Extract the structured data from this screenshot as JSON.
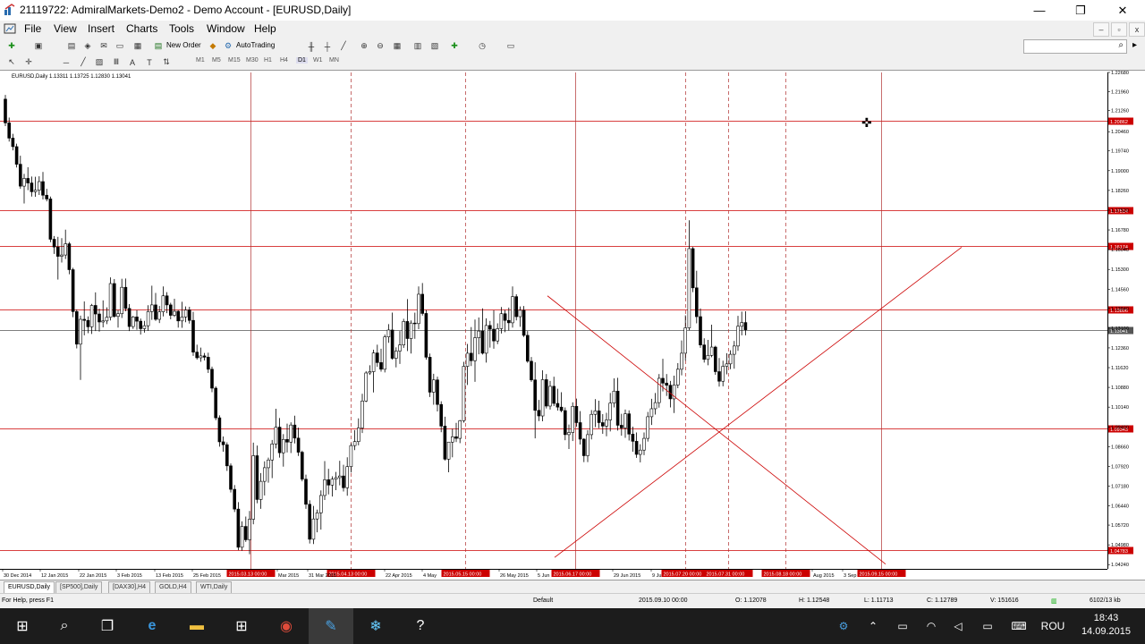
{
  "window": {
    "title": "21119722: AdmiralMarkets-Demo2 - Demo Account - [EURUSD,Daily]",
    "minimize": "—",
    "maximize": "❐",
    "close": "✕"
  },
  "menu": {
    "items": [
      "File",
      "View",
      "Insert",
      "Charts",
      "Tools",
      "Window",
      "Help"
    ]
  },
  "mdi": {
    "minimize": "–",
    "restore": "▫",
    "close": "x"
  },
  "toolbar": {
    "new_order": "New Order",
    "autotrading": "AutoTrading",
    "timeframes": [
      "M1",
      "M5",
      "M15",
      "M30",
      "H1",
      "H4",
      "D1",
      "W1",
      "MN"
    ]
  },
  "chart_info": {
    "text": "EURUSD,Daily  1.13311 1.13725 1.12830 1.13041"
  },
  "chart_data": {
    "type": "candlestick",
    "symbol": "EURUSD",
    "timeframe": "Daily",
    "ylim": [
      1.0408,
      1.2268
    ],
    "y_ticks": [
      "1.22680",
      "1.21960",
      "1.21260",
      "1.20460",
      "1.19740",
      "1.19000",
      "1.18260",
      "1.17520",
      "1.16780",
      "1.16040",
      "1.15300",
      "1.14560",
      "1.13840",
      "1.13100",
      "1.12360",
      "1.11620",
      "1.10880",
      "1.10140",
      "1.09400",
      "1.08660",
      "1.07920",
      "1.07180",
      "1.06440",
      "1.05720",
      "1.04980",
      "1.04240"
    ],
    "x_ticks": [
      "30 Dec 2014",
      "12 Jan 2015",
      "22 Jan 2015",
      "3 Feb 2015",
      "13 Feb 2015",
      "25 Feb 2015",
      "Mar 2015",
      "31 Mar 2015",
      "22 Apr 2015",
      "4 May",
      "26 May 2015",
      "5 Jun",
      "29 Jun 2015",
      "9 Ju",
      "Aug 2015",
      "3 Sep"
    ],
    "hlines": [
      {
        "price": "1.20862",
        "color": "#cc0000"
      },
      {
        "price": "1.17514",
        "color": "#cc0000"
      },
      {
        "price": "1.16174",
        "color": "#cc0000"
      },
      {
        "price": "1.13806",
        "color": "#cc0000"
      },
      {
        "price": "1.13041",
        "color": "#555555"
      },
      {
        "price": "1.09343",
        "color": "#cc0000"
      },
      {
        "price": "1.04783",
        "color": "#cc0000"
      }
    ],
    "vline_labels": [
      "2015.03.13 00:00",
      "2015.04.13 00:00",
      "2015.05.15 00:00",
      "2015.06.17 00:00",
      "2015.07.20 00:00",
      "2015.07.31 00:00",
      "2015.08.18 00:00",
      "2015.09.15 00:00"
    ],
    "candles": [
      [
        1.2168,
        1.2184,
        1.2067,
        1.2079
      ],
      [
        1.2079,
        1.2099,
        1.2009,
        1.2022
      ],
      [
        1.2022,
        1.2038,
        1.1976,
        1.199
      ],
      [
        1.199,
        1.2001,
        1.1912,
        1.1924
      ],
      [
        1.1924,
        1.1956,
        1.1832,
        1.1842
      ],
      [
        1.1842,
        1.1888,
        1.1777,
        1.1871
      ],
      [
        1.1871,
        1.1913,
        1.1827,
        1.1854
      ],
      [
        1.1854,
        1.1878,
        1.1803,
        1.1821
      ],
      [
        1.1821,
        1.1877,
        1.1802,
        1.1827
      ],
      [
        1.1827,
        1.1879,
        1.1809,
        1.1859
      ],
      [
        1.1859,
        1.1895,
        1.1792,
        1.1808
      ],
      [
        1.1808,
        1.1832,
        1.1785,
        1.1794
      ],
      [
        1.1794,
        1.1803,
        1.1632,
        1.1643
      ],
      [
        1.1643,
        1.1655,
        1.1588,
        1.1614
      ],
      [
        1.1614,
        1.1652,
        1.1492,
        1.1579
      ],
      [
        1.1579,
        1.1647,
        1.1556,
        1.1584
      ],
      [
        1.1584,
        1.1679,
        1.1569,
        1.1626
      ],
      [
        1.1626,
        1.1633,
        1.1512,
        1.1529
      ],
      [
        1.1529,
        1.1536,
        1.1351,
        1.1372
      ],
      [
        1.1372,
        1.138,
        1.1234,
        1.125
      ],
      [
        1.125,
        1.1357,
        1.1116,
        1.1343
      ],
      [
        1.1343,
        1.141,
        1.1283,
        1.1339
      ],
      [
        1.1339,
        1.1354,
        1.1291,
        1.1315
      ],
      [
        1.1315,
        1.1401,
        1.1288,
        1.1395
      ],
      [
        1.1395,
        1.1444,
        1.1299,
        1.1363
      ],
      [
        1.1363,
        1.1383,
        1.1297,
        1.1333
      ],
      [
        1.1333,
        1.1414,
        1.1313,
        1.1337
      ],
      [
        1.1337,
        1.1388,
        1.1325,
        1.1351
      ],
      [
        1.1351,
        1.15,
        1.1339,
        1.1477
      ],
      [
        1.1477,
        1.1494,
        1.1349,
        1.1354
      ],
      [
        1.1354,
        1.1378,
        1.1312,
        1.1364
      ],
      [
        1.1364,
        1.1495,
        1.1348,
        1.1463
      ],
      [
        1.1463,
        1.1496,
        1.1373,
        1.1384
      ],
      [
        1.1384,
        1.14,
        1.1299,
        1.1316
      ],
      [
        1.1316,
        1.1356,
        1.1307,
        1.1352
      ],
      [
        1.1352,
        1.1377,
        1.1304,
        1.1336
      ],
      [
        1.1336,
        1.1346,
        1.1286,
        1.1308
      ],
      [
        1.1308,
        1.1337,
        1.1293,
        1.1319
      ],
      [
        1.1319,
        1.1396,
        1.13,
        1.1372
      ],
      [
        1.1372,
        1.1469,
        1.1341,
        1.1397
      ],
      [
        1.1397,
        1.1442,
        1.1337,
        1.1343
      ],
      [
        1.1343,
        1.1393,
        1.1329,
        1.1371
      ],
      [
        1.1371,
        1.1466,
        1.1354,
        1.1431
      ],
      [
        1.1431,
        1.1445,
        1.1366,
        1.1397
      ],
      [
        1.1397,
        1.1405,
        1.1343,
        1.1358
      ],
      [
        1.1358,
        1.142,
        1.1352,
        1.1373
      ],
      [
        1.1373,
        1.1377,
        1.1312,
        1.1337
      ],
      [
        1.1337,
        1.1409,
        1.1311,
        1.1352
      ],
      [
        1.1352,
        1.1391,
        1.1332,
        1.1378
      ],
      [
        1.1378,
        1.139,
        1.1327,
        1.1339
      ],
      [
        1.1339,
        1.1371,
        1.1206,
        1.122
      ],
      [
        1.122,
        1.1248,
        1.1192,
        1.1199
      ],
      [
        1.1199,
        1.1237,
        1.1184,
        1.1206
      ],
      [
        1.1206,
        1.1217,
        1.1189,
        1.1201
      ],
      [
        1.1201,
        1.1218,
        1.1142,
        1.1156
      ],
      [
        1.1156,
        1.1166,
        1.107,
        1.1085
      ],
      [
        1.1085,
        1.1092,
        1.0965,
        1.0974
      ],
      [
        1.0974,
        1.0983,
        1.0866,
        1.0884
      ],
      [
        1.0884,
        1.0904,
        1.0847,
        1.0873
      ],
      [
        1.0873,
        1.0882,
        1.0775,
        1.0794
      ],
      [
        1.0794,
        1.0803,
        1.0694,
        1.0706
      ],
      [
        1.0706,
        1.0722,
        1.0621,
        1.0632
      ],
      [
        1.0632,
        1.0658,
        1.0478,
        1.0489
      ],
      [
        1.0489,
        1.0586,
        1.0476,
        1.0567
      ],
      [
        1.0567,
        1.0604,
        1.0509,
        1.0517
      ],
      [
        1.0517,
        1.0625,
        1.0463,
        1.0594
      ],
      [
        1.0594,
        1.0881,
        1.0575,
        1.0832
      ],
      [
        1.0832,
        1.087,
        1.0654,
        1.0668
      ],
      [
        1.0668,
        1.0767,
        1.0633,
        1.0736
      ],
      [
        1.0736,
        1.0811,
        1.0683,
        1.0787
      ],
      [
        1.0787,
        1.0825,
        1.0731,
        1.0816
      ],
      [
        1.0816,
        1.0891,
        1.0748,
        1.0876
      ],
      [
        1.0876,
        1.1008,
        1.0859,
        1.0939
      ],
      [
        1.0939,
        1.0973,
        1.0825,
        1.0843
      ],
      [
        1.0843,
        1.0913,
        1.0791,
        1.0893
      ],
      [
        1.0893,
        1.0952,
        1.0844,
        1.0883
      ],
      [
        1.0883,
        1.0957,
        1.0842,
        1.0947
      ],
      [
        1.0947,
        1.0982,
        1.0878,
        1.0898
      ],
      [
        1.0898,
        1.0937,
        1.0831,
        1.0845
      ],
      [
        1.0845,
        1.0851,
        1.0736,
        1.0744
      ],
      [
        1.0744,
        1.0761,
        1.0633,
        1.065
      ],
      [
        1.065,
        1.0665,
        1.0503,
        1.0519
      ],
      [
        1.0519,
        1.0644,
        1.0501,
        1.0595
      ],
      [
        1.0595,
        1.063,
        1.0545,
        1.0618
      ],
      [
        1.0618,
        1.0702,
        1.0555,
        1.0683
      ],
      [
        1.0683,
        1.0812,
        1.0666,
        1.0742
      ],
      [
        1.0742,
        1.0783,
        1.0687,
        1.0722
      ],
      [
        1.0722,
        1.0755,
        1.0679,
        1.0744
      ],
      [
        1.0744,
        1.0771,
        1.0703,
        1.075
      ],
      [
        1.075,
        1.0813,
        1.0721,
        1.0756
      ],
      [
        1.0756,
        1.0798,
        1.0698,
        1.0712
      ],
      [
        1.0712,
        1.0826,
        1.0682,
        1.0791
      ],
      [
        1.0791,
        1.0879,
        1.0769,
        1.087
      ],
      [
        1.087,
        1.0928,
        1.0853,
        1.0885
      ],
      [
        1.0885,
        1.0972,
        1.0871,
        1.0936
      ],
      [
        1.0936,
        1.1064,
        1.0917,
        1.1037
      ],
      [
        1.1037,
        1.1149,
        1.1033,
        1.1142
      ],
      [
        1.1142,
        1.1171,
        1.1135,
        1.1147
      ],
      [
        1.1147,
        1.1229,
        1.1069,
        1.1217
      ],
      [
        1.1217,
        1.1248,
        1.1165,
        1.1181
      ],
      [
        1.1181,
        1.1233,
        1.1147,
        1.1156
      ],
      [
        1.1156,
        1.1286,
        1.1144,
        1.1277
      ],
      [
        1.1277,
        1.1325,
        1.1255,
        1.1303
      ],
      [
        1.1303,
        1.1368,
        1.1192,
        1.1197
      ],
      [
        1.1197,
        1.1238,
        1.1163,
        1.1224
      ],
      [
        1.1224,
        1.1299,
        1.1176,
        1.1247
      ],
      [
        1.1247,
        1.1345,
        1.1236,
        1.1335
      ],
      [
        1.1335,
        1.1419,
        1.1224,
        1.1271
      ],
      [
        1.1271,
        1.1339,
        1.1215,
        1.1329
      ],
      [
        1.1329,
        1.1368,
        1.127,
        1.1327
      ],
      [
        1.1327,
        1.1466,
        1.1306,
        1.1437
      ],
      [
        1.1437,
        1.1479,
        1.1357,
        1.1365
      ],
      [
        1.1365,
        1.1378,
        1.1192,
        1.1201
      ],
      [
        1.1201,
        1.1215,
        1.1052,
        1.107
      ],
      [
        1.107,
        1.1139,
        1.1023,
        1.1116
      ],
      [
        1.1116,
        1.1128,
        1.0998,
        1.1024
      ],
      [
        1.1024,
        1.1036,
        1.092,
        1.0943
      ],
      [
        1.0943,
        1.0978,
        1.0814,
        1.0819
      ],
      [
        1.0819,
        1.0884,
        1.077,
        1.0883
      ],
      [
        1.0883,
        1.0933,
        1.0826,
        1.0903
      ],
      [
        1.0903,
        1.0955,
        1.0883,
        1.0897
      ],
      [
        1.0897,
        1.0966,
        1.0879,
        1.0963
      ],
      [
        1.0963,
        1.1184,
        1.0956,
        1.1167
      ],
      [
        1.1167,
        1.1251,
        1.1097,
        1.1216
      ],
      [
        1.1216,
        1.1314,
        1.1168,
        1.1188
      ],
      [
        1.1188,
        1.1342,
        1.1109,
        1.1274
      ],
      [
        1.1274,
        1.135,
        1.1212,
        1.1299
      ],
      [
        1.1299,
        1.1384,
        1.1211,
        1.1216
      ],
      [
        1.1216,
        1.1347,
        1.1181,
        1.132
      ],
      [
        1.132,
        1.1337,
        1.1237,
        1.1306
      ],
      [
        1.1306,
        1.1377,
        1.1233,
        1.1262
      ],
      [
        1.1262,
        1.1328,
        1.125,
        1.1308
      ],
      [
        1.1308,
        1.1389,
        1.129,
        1.1364
      ],
      [
        1.1364,
        1.1378,
        1.1295,
        1.1339
      ],
      [
        1.1339,
        1.1387,
        1.1301,
        1.133
      ],
      [
        1.133,
        1.1466,
        1.1312,
        1.1428
      ],
      [
        1.1428,
        1.1437,
        1.1339,
        1.1353
      ],
      [
        1.1353,
        1.1391,
        1.1315,
        1.1377
      ],
      [
        1.1377,
        1.1393,
        1.1277,
        1.1283
      ],
      [
        1.1283,
        1.1299,
        1.118,
        1.1186
      ],
      [
        1.1186,
        1.1202,
        1.1109,
        1.1116
      ],
      [
        1.1116,
        1.1182,
        1.0897,
        1.1002
      ],
      [
        1.1002,
        1.1041,
        1.0962,
        1.0981
      ],
      [
        1.0981,
        1.1152,
        1.0961,
        1.1117
      ],
      [
        1.1117,
        1.1138,
        1.1009,
        1.1018
      ],
      [
        1.1018,
        1.1112,
        1.1005,
        1.1092
      ],
      [
        1.1092,
        1.1128,
        1.1018,
        1.1028
      ],
      [
        1.1028,
        1.1083,
        1.1001,
        1.1014
      ],
      [
        1.1014,
        1.107,
        1.0995,
        1.1001
      ],
      [
        1.1001,
        1.1013,
        1.089,
        1.0911
      ],
      [
        1.0911,
        1.0949,
        1.0857,
        1.0919
      ],
      [
        1.0919,
        1.1032,
        1.0887,
        1.1017
      ],
      [
        1.1017,
        1.1046,
        1.0941,
        1.0956
      ],
      [
        1.0956,
        1.0999,
        1.0874,
        1.0894
      ],
      [
        1.0894,
        1.0898,
        1.0808,
        1.0832
      ],
      [
        1.0832,
        1.0928,
        1.0808,
        1.0911
      ],
      [
        1.0911,
        1.1003,
        1.0893,
        1.0987
      ],
      [
        1.0987,
        1.1044,
        1.0939,
        1.1
      ],
      [
        1.1,
        1.1038,
        1.0935,
        1.0956
      ],
      [
        1.0956,
        1.0988,
        1.0914,
        1.0943
      ],
      [
        1.0943,
        1.0993,
        1.0905,
        1.0966
      ],
      [
        1.0966,
        1.1067,
        1.0923,
        1.1029
      ],
      [
        1.1029,
        1.1122,
        1.1013,
        1.1074
      ],
      [
        1.1074,
        1.1124,
        1.0926,
        1.0946
      ],
      [
        1.0946,
        1.0989,
        1.0907,
        1.0936
      ],
      [
        1.0936,
        1.1005,
        1.0899,
        1.0989
      ],
      [
        1.0989,
        1.1002,
        1.0889,
        1.0913
      ],
      [
        1.0913,
        1.0941,
        1.0847,
        1.0886
      ],
      [
        1.0886,
        1.0919,
        1.0824,
        1.0837
      ],
      [
        1.0837,
        1.0875,
        1.0807,
        1.0853
      ],
      [
        1.0853,
        1.0919,
        1.0834,
        1.0897
      ],
      [
        1.0897,
        1.0996,
        1.0885,
        1.0978
      ],
      [
        1.0978,
        1.1045,
        1.0947,
        1.1008
      ],
      [
        1.1008,
        1.1067,
        1.0986,
        1.1031
      ],
      [
        1.1031,
        1.1138,
        1.1012,
        1.1122
      ],
      [
        1.1122,
        1.1195,
        1.1073,
        1.1104
      ],
      [
        1.1104,
        1.1138,
        1.1056,
        1.1096
      ],
      [
        1.1096,
        1.1112,
        1.1013,
        1.1045
      ],
      [
        1.1045,
        1.1132,
        1.0992,
        1.1097
      ],
      [
        1.1097,
        1.1179,
        1.1085,
        1.1156
      ],
      [
        1.1156,
        1.1264,
        1.1133,
        1.1216
      ],
      [
        1.1216,
        1.1358,
        1.1188,
        1.1311
      ],
      [
        1.1311,
        1.1714,
        1.1302,
        1.1608
      ],
      [
        1.1608,
        1.1614,
        1.1445,
        1.1461
      ],
      [
        1.1461,
        1.1525,
        1.1328,
        1.1353
      ],
      [
        1.1353,
        1.1384,
        1.1236,
        1.1247
      ],
      [
        1.1247,
        1.1272,
        1.1181,
        1.1193
      ],
      [
        1.1193,
        1.1266,
        1.1171,
        1.1208
      ],
      [
        1.1208,
        1.1323,
        1.1201,
        1.1239
      ],
      [
        1.1239,
        1.1244,
        1.1135,
        1.1147
      ],
      [
        1.1147,
        1.1198,
        1.1091,
        1.1111
      ],
      [
        1.1111,
        1.1188,
        1.1092,
        1.1167
      ],
      [
        1.1167,
        1.1216,
        1.1137,
        1.1176
      ],
      [
        1.1176,
        1.1227,
        1.1156,
        1.1212
      ],
      [
        1.1212,
        1.1262,
        1.1158,
        1.1243
      ],
      [
        1.1243,
        1.1356,
        1.1225,
        1.1317
      ],
      [
        1.1317,
        1.1372,
        1.1283,
        1.1331
      ],
      [
        1.1331,
        1.1373,
        1.1283,
        1.1304
      ]
    ]
  },
  "drawings": {
    "trendline_up_start": {
      "date": "2015.06.18",
      "price": 1.0451
    },
    "trendline_up_end": {
      "date": "2015.09.08",
      "price": 1.1613
    },
    "trendline_down_start": {
      "date": "2015.05.22",
      "price": 1.1431
    },
    "trendline_down_end": {
      "date": "2015.09.14",
      "price": 1.0426
    }
  },
  "tabs": [
    "EURUSD,Daily",
    "[SP500],Daily",
    "[DAX30],H4",
    "GOLD,H4",
    "WTI,Daily"
  ],
  "status": {
    "help": "For Help, press F1",
    "profile": "Default",
    "datetime": "2015.09.10 00:00",
    "open": "O: 1.12078",
    "high": "H: 1.12548",
    "low": "L: 1.11713",
    "close": "C: 1.12789",
    "volume": "V: 151616",
    "traffic": "6102/13 kb"
  },
  "taskbar": {
    "lang": "ROU",
    "time": "18:43",
    "date": "14.09.2015"
  }
}
